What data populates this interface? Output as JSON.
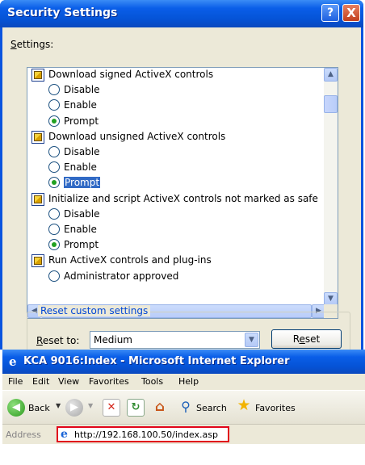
{
  "dialog": {
    "title": "Security Settings",
    "help_glyph": "?",
    "close_glyph": "X",
    "settings_label_accel": "S",
    "settings_label_rest": "ettings:",
    "tree": [
      {
        "kind": "group",
        "label": "Download signed ActiveX controls"
      },
      {
        "kind": "option",
        "label": "Disable",
        "checked": false
      },
      {
        "kind": "option",
        "label": "Enable",
        "checked": false
      },
      {
        "kind": "option",
        "label": "Prompt",
        "checked": true
      },
      {
        "kind": "group",
        "label": "Download unsigned ActiveX controls"
      },
      {
        "kind": "option",
        "label": "Disable",
        "checked": false
      },
      {
        "kind": "option",
        "label": "Enable",
        "checked": false
      },
      {
        "kind": "option",
        "label": "Prompt",
        "checked": true,
        "selected": true
      },
      {
        "kind": "group",
        "label": "Initialize and script ActiveX controls not marked as safe"
      },
      {
        "kind": "option",
        "label": "Disable",
        "checked": false
      },
      {
        "kind": "option",
        "label": "Enable",
        "checked": false
      },
      {
        "kind": "option",
        "label": "Prompt",
        "checked": true
      },
      {
        "kind": "group",
        "label": "Run ActiveX controls and plug-ins"
      },
      {
        "kind": "option",
        "label": "Administrator approved",
        "checked": false
      }
    ],
    "reset_group_label": "Reset custom settings",
    "reset_to_accel": "R",
    "reset_to_rest": "eset to:",
    "reset_level": "Medium",
    "reset_button_pre": "R",
    "reset_button_accel": "e",
    "reset_button_post": "set"
  },
  "ie": {
    "title": "KCA 9016:Index - Microsoft Internet Explorer",
    "menu": [
      "File",
      "Edit",
      "View",
      "Favorites",
      "Tools",
      "Help"
    ],
    "toolbar": {
      "back": "Back",
      "search": "Search",
      "favorites": "Favorites"
    },
    "address_label": "Address",
    "url": "http://192.168.100.50/index.asp"
  },
  "colors": {
    "selection": "#316ac5",
    "address_highlight": "#e1051b",
    "radio_checked": "#21a121"
  }
}
